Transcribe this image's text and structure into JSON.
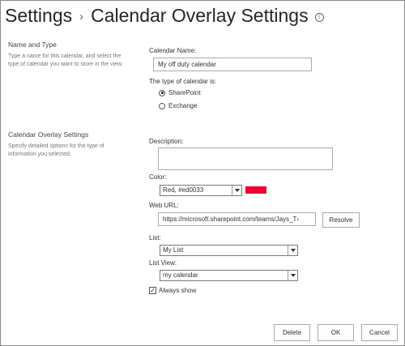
{
  "header": {
    "breadcrumb_root": "Settings",
    "separator": "›",
    "page_title": "Calendar Overlay Settings",
    "info_icon_glyph": "i"
  },
  "sections": {
    "name_type": {
      "title": "Name and Type",
      "description": "Type a name for this calendar, and select the type of calendar you want to store in the view."
    },
    "overlay": {
      "title": "Calendar Overlay Settings",
      "description": "Specify detailed options for the type of information you selected."
    }
  },
  "form": {
    "calendar_name_label": "Calendar Name:",
    "calendar_name_value": "My off duty calendar",
    "calendar_type_label": "The type of calendar is:",
    "type_options": [
      "SharePoint",
      "Exchange"
    ],
    "type_selected": "SharePoint",
    "description_label": "Description:",
    "description_value": "",
    "color_label": "Color:",
    "color_value": "Red, #ed0033",
    "color_hex": "#ed0033",
    "web_url_label": "Web URL:",
    "web_url_value": "https://microsoft.sharepoint.com/teams/Jays_T‹",
    "resolve_button": "Resolve",
    "list_label": "List:",
    "list_value": "My List",
    "list_view_label": "List View:",
    "list_view_value": "my calendar",
    "always_show_label": "Always show",
    "always_show_checked": true
  },
  "footer": {
    "delete_button": "Delete",
    "ok_button": "OK",
    "cancel_button": "Cancel"
  },
  "icons": {
    "info": "info-icon",
    "dropdown": "chevron-down-icon",
    "check": "checkmark-icon"
  }
}
